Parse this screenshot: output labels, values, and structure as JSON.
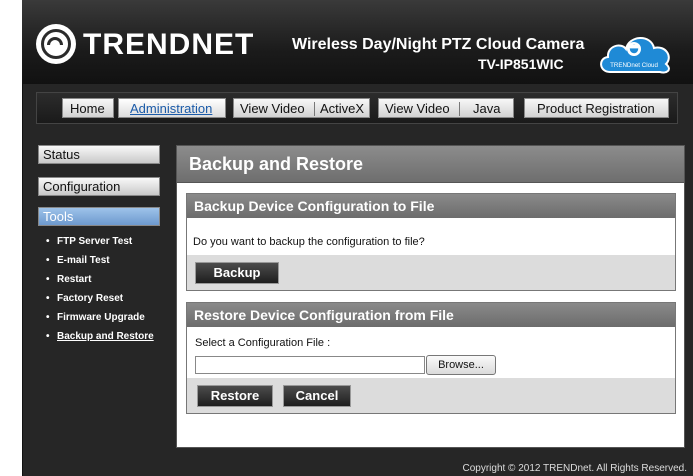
{
  "header": {
    "brand": "TRENDNET",
    "product_title": "Wireless Day/Night PTZ Cloud Camera",
    "model": "TV-IP851WIC",
    "cloud_badge": "TRENDnet Cloud"
  },
  "nav": {
    "home": "Home",
    "administration": "Administration",
    "view_video_activex": {
      "left": "View Video",
      "right": "ActiveX"
    },
    "view_video_java": {
      "left": "View Video",
      "right": "Java"
    },
    "product_registration": "Product Registration"
  },
  "sidebar": {
    "status": "Status",
    "configuration": "Configuration",
    "tools": "Tools",
    "bullet": "•",
    "items": [
      {
        "label": "FTP Server Test"
      },
      {
        "label": "E-mail Test"
      },
      {
        "label": "Restart"
      },
      {
        "label": "Factory Reset"
      },
      {
        "label": "Firmware Upgrade"
      },
      {
        "label": "Backup and Restore"
      }
    ]
  },
  "main": {
    "title": "Backup and Restore",
    "backup": {
      "heading": "Backup Device Configuration to File",
      "question": "Do you want to backup the configuration to file?",
      "button": "Backup"
    },
    "restore": {
      "heading": "Restore Device Configuration from File",
      "file_label": "Select a Configuration File :",
      "file_value": "",
      "browse": "Browse...",
      "restore_button": "Restore",
      "cancel_button": "Cancel"
    }
  },
  "footer": {
    "copyright": "Copyright © 2012 TRENDnet.  All Rights Reserved."
  },
  "colors": {
    "accent_active": "#1a5aa8",
    "cloud_blue": "#1f8ad6",
    "section_header": "#7a7a7a"
  }
}
